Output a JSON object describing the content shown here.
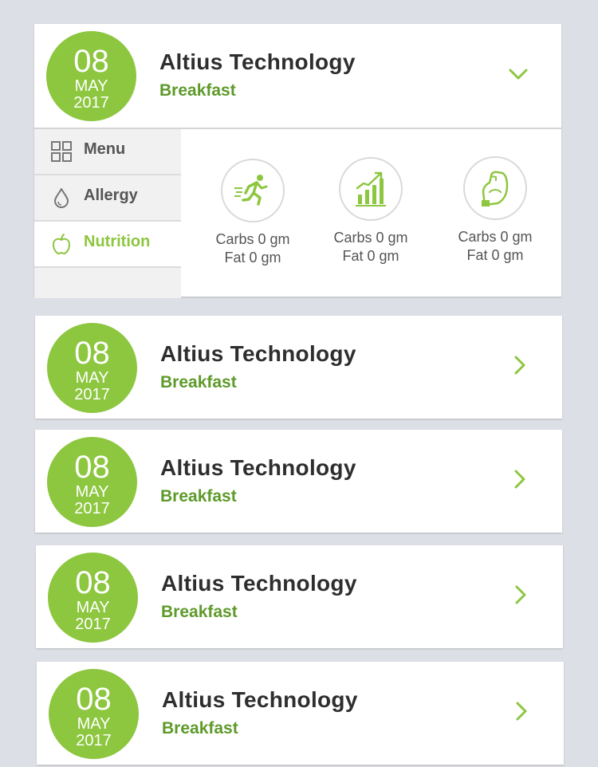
{
  "entries": [
    {
      "day": "08",
      "month": "MAY",
      "year": "2017",
      "title": "Altius Technology",
      "subtitle": "Breakfast",
      "expanded": true
    },
    {
      "day": "08",
      "month": "MAY",
      "year": "2017",
      "title": "Altius Technology",
      "subtitle": "Breakfast",
      "expanded": false
    },
    {
      "day": "08",
      "month": "MAY",
      "year": "2017",
      "title": "Altius Technology",
      "subtitle": "Breakfast",
      "expanded": false
    },
    {
      "day": "08",
      "month": "MAY",
      "year": "2017",
      "title": "Altius Technology",
      "subtitle": "Breakfast",
      "expanded": false
    },
    {
      "day": "08",
      "month": "MAY",
      "year": "2017",
      "title": "Altius Technology",
      "subtitle": "Breakfast",
      "expanded": false
    }
  ],
  "tabs": [
    {
      "label": "Menu",
      "icon": "grid-icon",
      "active": false
    },
    {
      "label": "Allergy",
      "icon": "drop-icon",
      "active": false
    },
    {
      "label": "Nutrition",
      "icon": "apple-icon",
      "active": true
    }
  ],
  "stats": [
    {
      "icon": "running-man-icon",
      "carbs": "Carbs 0 gm",
      "fat": "Fat 0 gm"
    },
    {
      "icon": "growth-chart-icon",
      "carbs": "Carbs 0 gm",
      "fat": "Fat 0 gm"
    },
    {
      "icon": "flexed-arm-icon",
      "carbs": "Carbs 0 gm",
      "fat": "Fat 0 gm"
    }
  ],
  "colors": {
    "accent": "#8dc63f",
    "accent_dark": "#5e9a2a",
    "background": "#dddfe6"
  }
}
